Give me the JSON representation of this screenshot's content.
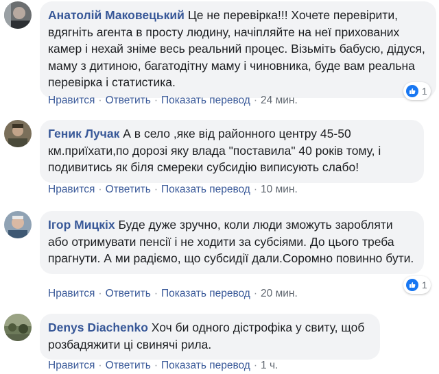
{
  "comments": [
    {
      "author": "Анатолій Маковецький",
      "text": "Це не перевірка!!! Хочете перевірити, вдягніть агента в просту людину, начіпляйте на неї прихованих камер і нехай зніме весь реальний процес. Візьміть бабусю, дідуся, маму з дитиною, багатодітну маму і чиновника, буде вам реальна перевірка і статистика.",
      "like_count": "1",
      "time": "24 мин."
    },
    {
      "author": "Геник Лучак",
      "text": "А в село ,яке від районного центру 45-50 км.приїхати,по дорозі яку влада \"поставила\" 40 років тому, і подивитись як біля смереки субсидію виписують слабо!",
      "time": "10 мин."
    },
    {
      "author": "Ігор Мицкіх",
      "text": "Буде дуже зручно, коли люди зможуть заробляти або отримувати пенсії і не ходити за субсіями. До цього треба прагнути. А ми радіємо, що субсидії дали.Соромно повинно бути.",
      "like_count": "1",
      "time": "20 мин."
    },
    {
      "author": "Denys Diachenko",
      "text": "Хоч би одного дістрофіка у свиту, щоб розбадяжити ці свинячі рила.",
      "time": "1 ч."
    }
  ],
  "actions": {
    "like": "Нравится",
    "reply": "Ответить",
    "translate": "Показать перевод",
    "separator": "·"
  },
  "colors": {
    "author": "#385898",
    "bubble": "#f2f3f5",
    "meta": "#606770",
    "like": "#1877f2"
  }
}
